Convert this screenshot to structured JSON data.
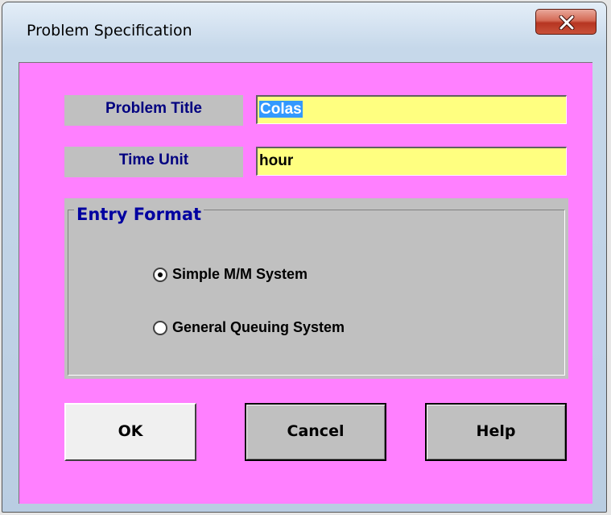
{
  "window": {
    "title": "Problem Specification",
    "close_label": "Close"
  },
  "form": {
    "problem_title_label": "Problem Title",
    "problem_title_value": "Colas",
    "time_unit_label": "Time Unit",
    "time_unit_value": "hour"
  },
  "entry_format": {
    "legend": "Entry Format",
    "options": [
      {
        "label": "Simple M/M System",
        "selected": true
      },
      {
        "label": "General Queuing System",
        "selected": false
      }
    ]
  },
  "buttons": {
    "ok": "OK",
    "cancel": "Cancel",
    "help": "Help"
  },
  "colors": {
    "client_background": "#ff80ff",
    "input_background": "#ffff80",
    "label_text": "#000080",
    "selection": "#3399ff"
  },
  "icons": {
    "close": "close-icon",
    "radio_selected": "radio-selected-icon",
    "radio_unselected": "radio-unselected-icon"
  }
}
